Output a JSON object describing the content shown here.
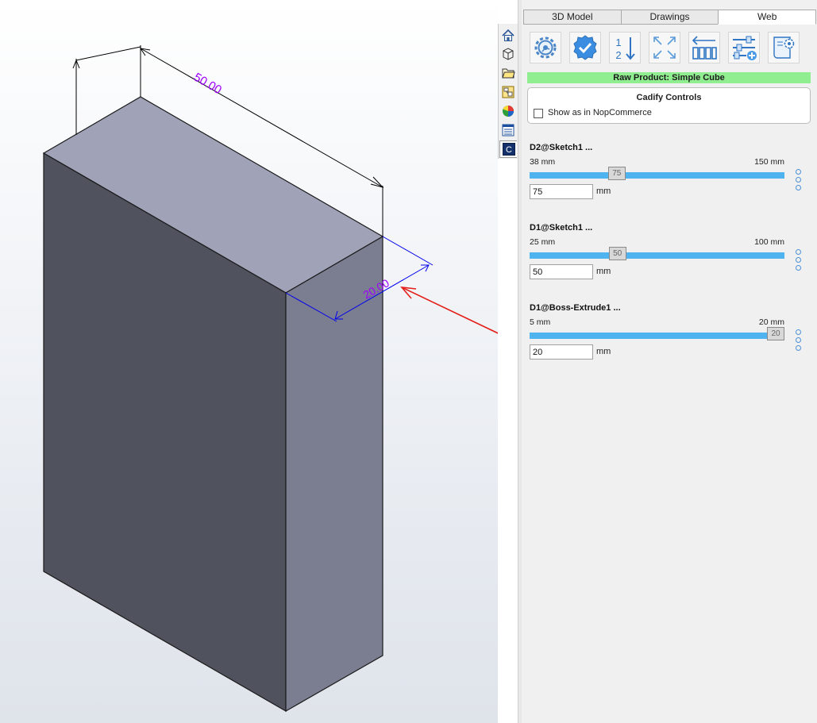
{
  "viewport": {
    "dimensions": {
      "width_label": "50.00",
      "depth_label": "20.00"
    },
    "colors": {
      "top_face": "#a0a3b8",
      "front_face": "#50525e",
      "side_face": "#7b7e90",
      "dimension_main": "#000000",
      "dimension_selected": "#0000ee",
      "dim_text": "#9b00ff",
      "arrow": "#e3201b"
    }
  },
  "task_strip": {
    "items": [
      {
        "icon": "home-icon"
      },
      {
        "icon": "part-icon"
      },
      {
        "icon": "folder-icon"
      },
      {
        "icon": "view-palette-icon"
      },
      {
        "icon": "appearance-icon"
      },
      {
        "icon": "custom-properties-icon"
      },
      {
        "icon": "cadify-icon",
        "label": "C",
        "active": true
      }
    ]
  },
  "panel": {
    "tabs": [
      {
        "label": "3D Model",
        "active": false
      },
      {
        "label": "Drawings",
        "active": false
      },
      {
        "label": "Web",
        "active": true
      }
    ],
    "toolbar": [
      {
        "icon": "gear-icon"
      },
      {
        "icon": "check-icon"
      },
      {
        "icon": "sort-order-icon",
        "label_top": "1",
        "label_bottom": "2"
      },
      {
        "icon": "expand-icon"
      },
      {
        "icon": "collapse-left-icon"
      },
      {
        "icon": "add-settings-icon"
      },
      {
        "icon": "drawing-settings-icon"
      }
    ],
    "product_banner": "Raw Product: Simple Cube",
    "cadify_controls": {
      "title": "Cadify Controls",
      "checkbox_label": "Show as in NopCommerce",
      "checked": false
    },
    "parameters": [
      {
        "name": "D2@Sketch1  ...",
        "min_label": "38 mm",
        "max_label": "150 mm",
        "min": 38,
        "max": 150,
        "value": 75,
        "value_text": "75",
        "unit": "mm"
      },
      {
        "name": "D1@Sketch1  ...",
        "min_label": "25 mm",
        "max_label": "100 mm",
        "min": 25,
        "max": 100,
        "value": 50,
        "value_text": "50",
        "unit": "mm"
      },
      {
        "name": "D1@Boss-Extrude1  ...",
        "min_label": "5 mm",
        "max_label": "20 mm",
        "min": 5,
        "max": 20,
        "value": 20,
        "value_text": "20",
        "unit": "mm"
      }
    ]
  }
}
